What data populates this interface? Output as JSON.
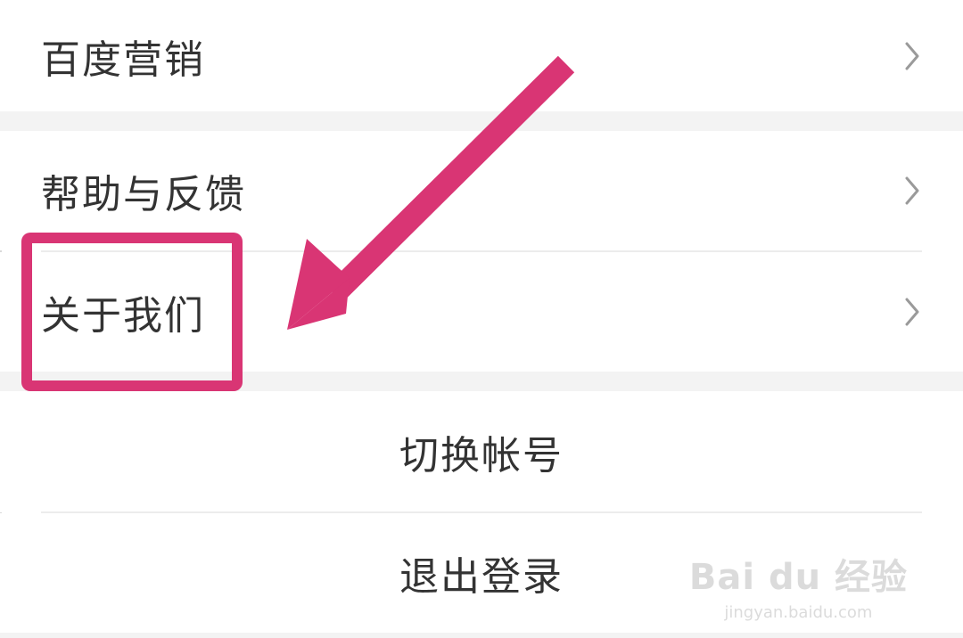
{
  "menu": {
    "marketing": "百度营销",
    "help": "帮助与反馈",
    "about": "关于我们",
    "switch_account": "切换帐号",
    "logout": "退出登录"
  },
  "icons": {
    "chevron": "chevron-right-icon",
    "arrow": "pointer-arrow-icon"
  },
  "colors": {
    "highlight": "#d93574",
    "text": "#333333",
    "gap": "#f3f3f3"
  },
  "watermark": {
    "logo": "Bai du 经验",
    "url": "jingyan.baidu.com"
  }
}
